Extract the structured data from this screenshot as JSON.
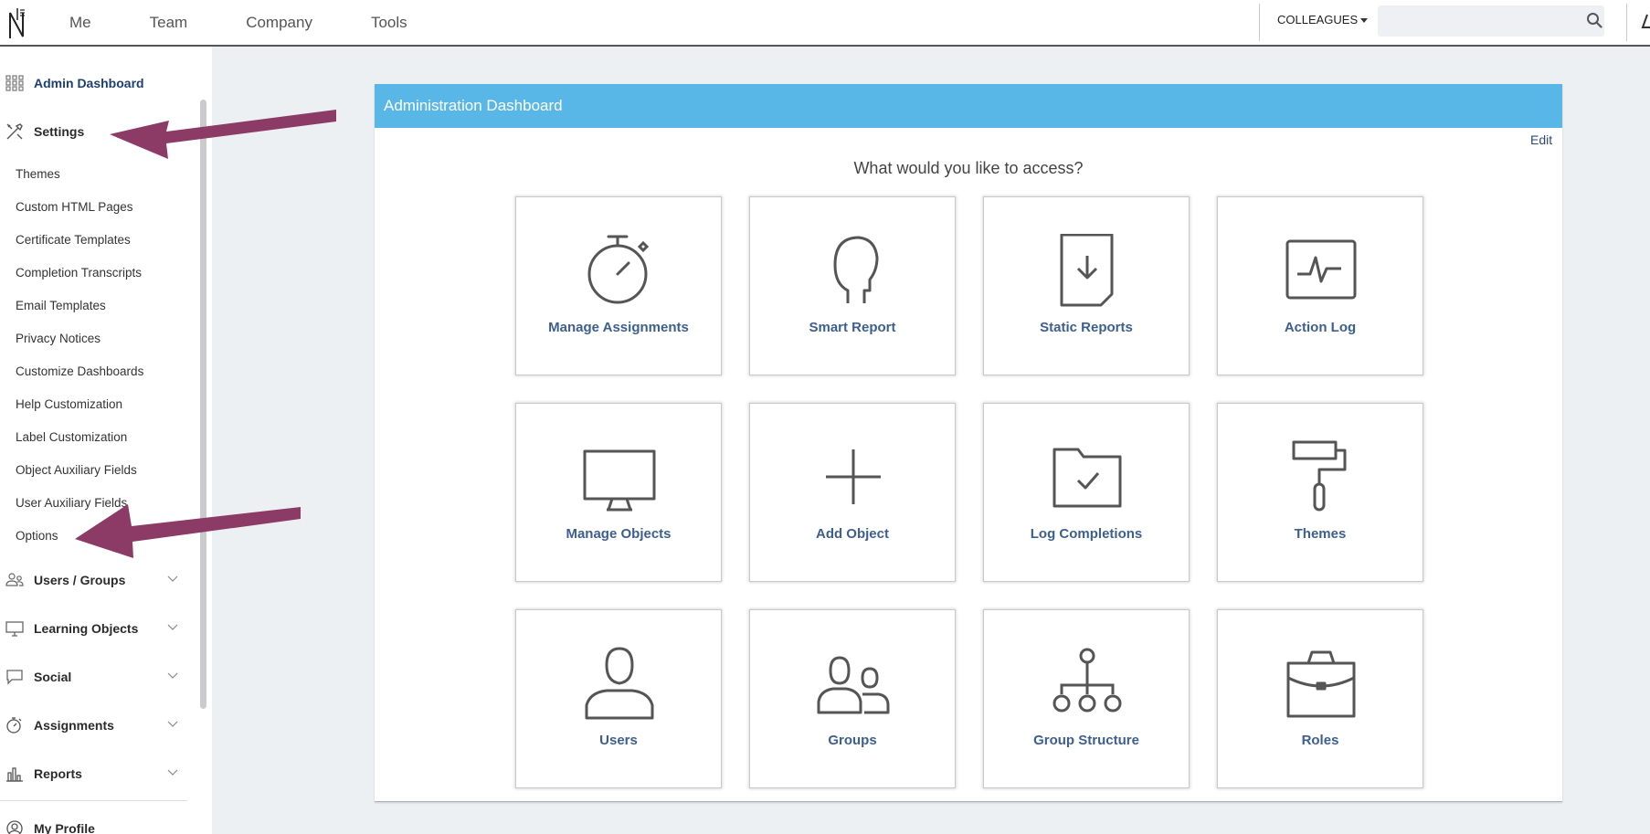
{
  "topnav": {
    "links": [
      "Me",
      "Team",
      "Company",
      "Tools"
    ],
    "colleagues_label": "COLLEAGUES",
    "search_value": "",
    "search_placeholder": ""
  },
  "sidebar": {
    "admin_dashboard": "Admin Dashboard",
    "settings": "Settings",
    "settings_items": [
      "Themes",
      "Custom HTML Pages",
      "Certificate Templates",
      "Completion Transcripts",
      "Email Templates",
      "Privacy Notices",
      "Customize Dashboards",
      "Help Customization",
      "Label Customization",
      "Object Auxiliary Fields",
      "User Auxiliary Fields",
      "Options"
    ],
    "sections": [
      "Users / Groups",
      "Learning Objects",
      "Social",
      "Assignments",
      "Reports"
    ],
    "my_profile": "My Profile"
  },
  "panel": {
    "title": "Administration Dashboard",
    "edit_label": "Edit",
    "question": "What would you like to access?",
    "tiles": [
      {
        "label": "Manage Assignments",
        "icon": "stopwatch-icon"
      },
      {
        "label": "Smart Report",
        "icon": "head-profile-icon"
      },
      {
        "label": "Static Reports",
        "icon": "document-download-icon"
      },
      {
        "label": "Action Log",
        "icon": "pulse-monitor-icon"
      },
      {
        "label": "Manage Objects",
        "icon": "monitor-icon"
      },
      {
        "label": "Add Object",
        "icon": "plus-icon"
      },
      {
        "label": "Log Completions",
        "icon": "folder-check-icon"
      },
      {
        "label": "Themes",
        "icon": "paint-roller-icon"
      },
      {
        "label": "Users",
        "icon": "user-icon"
      },
      {
        "label": "Groups",
        "icon": "group-icon"
      },
      {
        "label": "Group Structure",
        "icon": "hierarchy-icon"
      },
      {
        "label": "Roles",
        "icon": "briefcase-icon"
      }
    ]
  },
  "colors": {
    "header_blue": "#59b7e8",
    "tile_label": "#3d5f8f",
    "active_nav": "#1d3f73",
    "annotation_arrow": "#8c3a66"
  }
}
